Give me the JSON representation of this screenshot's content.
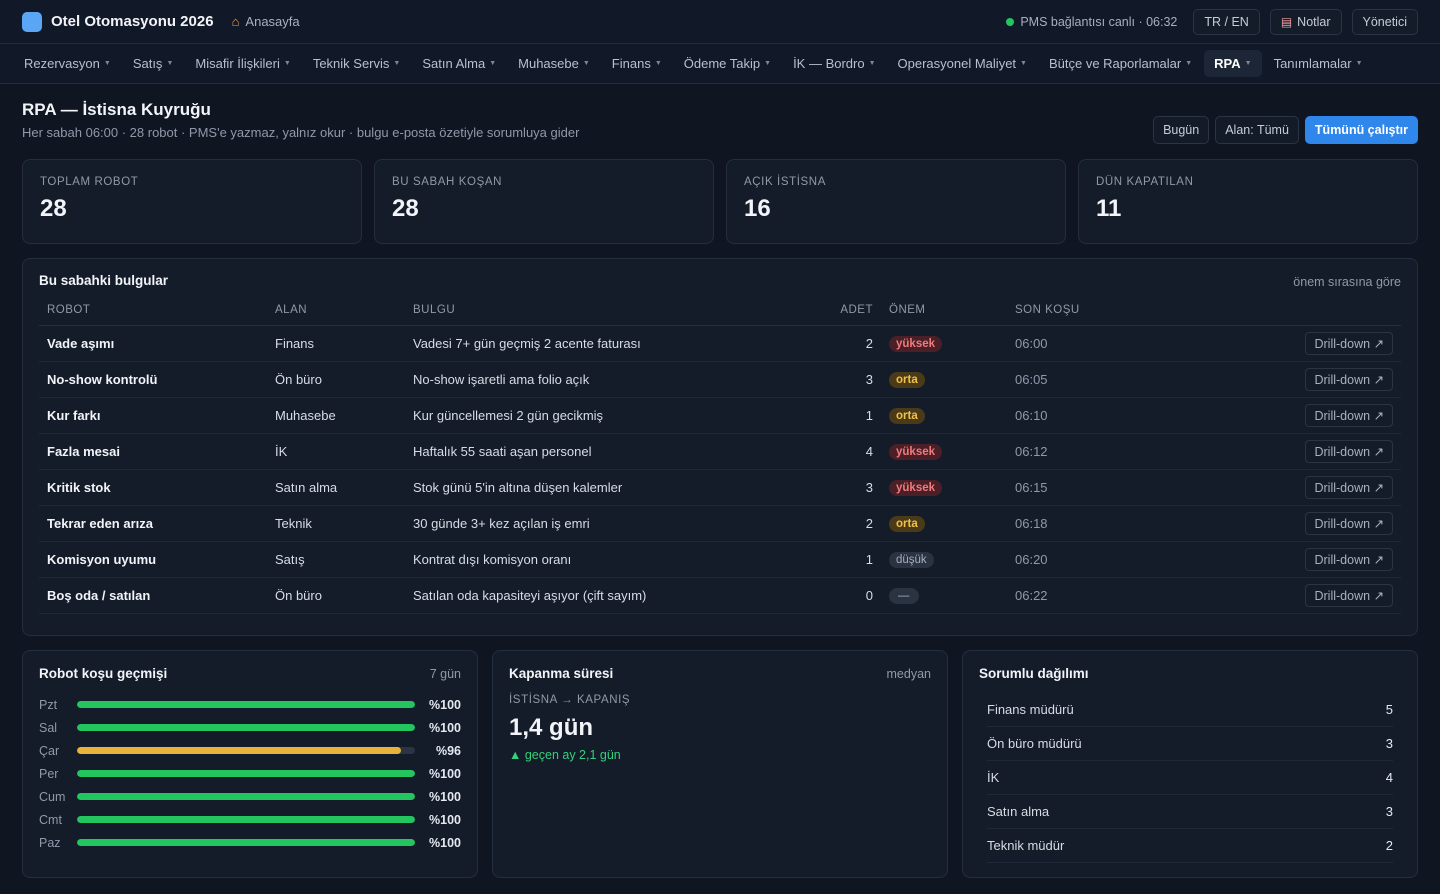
{
  "app": {
    "title": "Otel Otomasyonu 2026",
    "home_label": "Anasayfa",
    "status_text": "PMS bağlantısı canlı · 06:32",
    "lang_label": "TR / EN",
    "notes_label": "Notlar",
    "user_label": "Yönetici"
  },
  "nav": {
    "items": [
      {
        "label": "Rezervasyon"
      },
      {
        "label": "Satış"
      },
      {
        "label": "Misafir İlişkileri"
      },
      {
        "label": "Teknik Servis"
      },
      {
        "label": "Satın Alma"
      },
      {
        "label": "Muhasebe"
      },
      {
        "label": "Finans"
      },
      {
        "label": "Ödeme Takip"
      },
      {
        "label": "İK — Bordro"
      },
      {
        "label": "Operasyonel Maliyet"
      },
      {
        "label": "Bütçe ve Raporlamalar"
      },
      {
        "label": "RPA",
        "active": true
      },
      {
        "label": "Tanımlamalar"
      }
    ]
  },
  "page": {
    "title": "RPA — İstisna Kuyruğu",
    "subtitle": "Her sabah 06:00 · 28 robot · PMS'e yazmaz, yalnız okur · bulgu e-posta özetiyle sorumluya gider",
    "btn_today": "Bugün",
    "btn_area": "Alan: Tümü",
    "btn_run_all": "Tümünü çalıştır"
  },
  "kpis": [
    {
      "label": "TOPLAM ROBOT",
      "value": "28"
    },
    {
      "label": "BU SABAH KOŞAN",
      "value": "28"
    },
    {
      "label": "AÇIK İSTİSNA",
      "value": "16"
    },
    {
      "label": "DÜN KAPATILAN",
      "value": "11"
    }
  ],
  "findings": {
    "title": "Bu sabahki bulgular",
    "hint": "önem sırasına göre",
    "columns": {
      "robot": "ROBOT",
      "area": "ALAN",
      "finding": "BULGU",
      "count": "ADET",
      "severity": "ÖNEM",
      "last_run": "SON KOŞU"
    },
    "drill_label": "Drill-down ↗",
    "rows": [
      {
        "robot": "Vade aşımı",
        "area": "Finans",
        "finding": "Vadesi 7+ gün geçmiş 2 acente faturası",
        "count": "2",
        "severity": "yüksek",
        "level": "high",
        "last_run": "06:00"
      },
      {
        "robot": "No-show kontrolü",
        "area": "Ön büro",
        "finding": "No-show işaretli ama folio açık",
        "count": "3",
        "severity": "orta",
        "level": "mid",
        "last_run": "06:05"
      },
      {
        "robot": "Kur farkı",
        "area": "Muhasebe",
        "finding": "Kur güncellemesi 2 gün gecikmiş",
        "count": "1",
        "severity": "orta",
        "level": "mid",
        "last_run": "06:10"
      },
      {
        "robot": "Fazla mesai",
        "area": "İK",
        "finding": "Haftalık 55 saati aşan personel",
        "count": "4",
        "severity": "yüksek",
        "level": "high",
        "last_run": "06:12"
      },
      {
        "robot": "Kritik stok",
        "area": "Satın alma",
        "finding": "Stok günü 5'in altına düşen kalemler",
        "count": "3",
        "severity": "yüksek",
        "level": "high",
        "last_run": "06:15"
      },
      {
        "robot": "Tekrar eden arıza",
        "area": "Teknik",
        "finding": "30 günde 3+ kez açılan iş emri",
        "count": "2",
        "severity": "orta",
        "level": "mid",
        "last_run": "06:18"
      },
      {
        "robot": "Komisyon uyumu",
        "area": "Satış",
        "finding": "Kontrat dışı komisyon oranı",
        "count": "1",
        "severity": "düşük",
        "level": "low",
        "last_run": "06:20"
      },
      {
        "robot": "Boş oda / satılan",
        "area": "Ön büro",
        "finding": "Satılan oda kapasiteyi aşıyor (çift sayım)",
        "count": "0",
        "severity": "—",
        "level": "none",
        "last_run": "06:22"
      }
    ]
  },
  "run_history": {
    "title": "Robot koşu geçmişi",
    "hint": "7 gün",
    "days": [
      {
        "day": "Pzt",
        "pct_label": "%100",
        "fraction": 1.0,
        "color": "#22c55e"
      },
      {
        "day": "Sal",
        "pct_label": "%100",
        "fraction": 1.0,
        "color": "#22c55e"
      },
      {
        "day": "Çar",
        "pct_label": "%96",
        "fraction": 0.96,
        "color": "#e9b23a"
      },
      {
        "day": "Per",
        "pct_label": "%100",
        "fraction": 1.0,
        "color": "#22c55e"
      },
      {
        "day": "Cum",
        "pct_label": "%100",
        "fraction": 1.0,
        "color": "#22c55e"
      },
      {
        "day": "Cmt",
        "pct_label": "%100",
        "fraction": 1.0,
        "color": "#22c55e"
      },
      {
        "day": "Paz",
        "pct_label": "%100",
        "fraction": 1.0,
        "color": "#22c55e"
      }
    ]
  },
  "close_time": {
    "title": "Kapanma süresi",
    "hint": "medyan",
    "label": "İSTİSNA → KAPANIŞ",
    "value": "1,4 gün",
    "trend": "▲ geçen ay 2,1 gün"
  },
  "responsible": {
    "title": "Sorumlu dağılımı",
    "rows": [
      {
        "name": "Finans müdürü",
        "count": "5"
      },
      {
        "name": "Ön büro müdürü",
        "count": "3"
      },
      {
        "name": "İK",
        "count": "4"
      },
      {
        "name": "Satın alma",
        "count": "3"
      },
      {
        "name": "Teknik müdür",
        "count": "2"
      }
    ]
  }
}
